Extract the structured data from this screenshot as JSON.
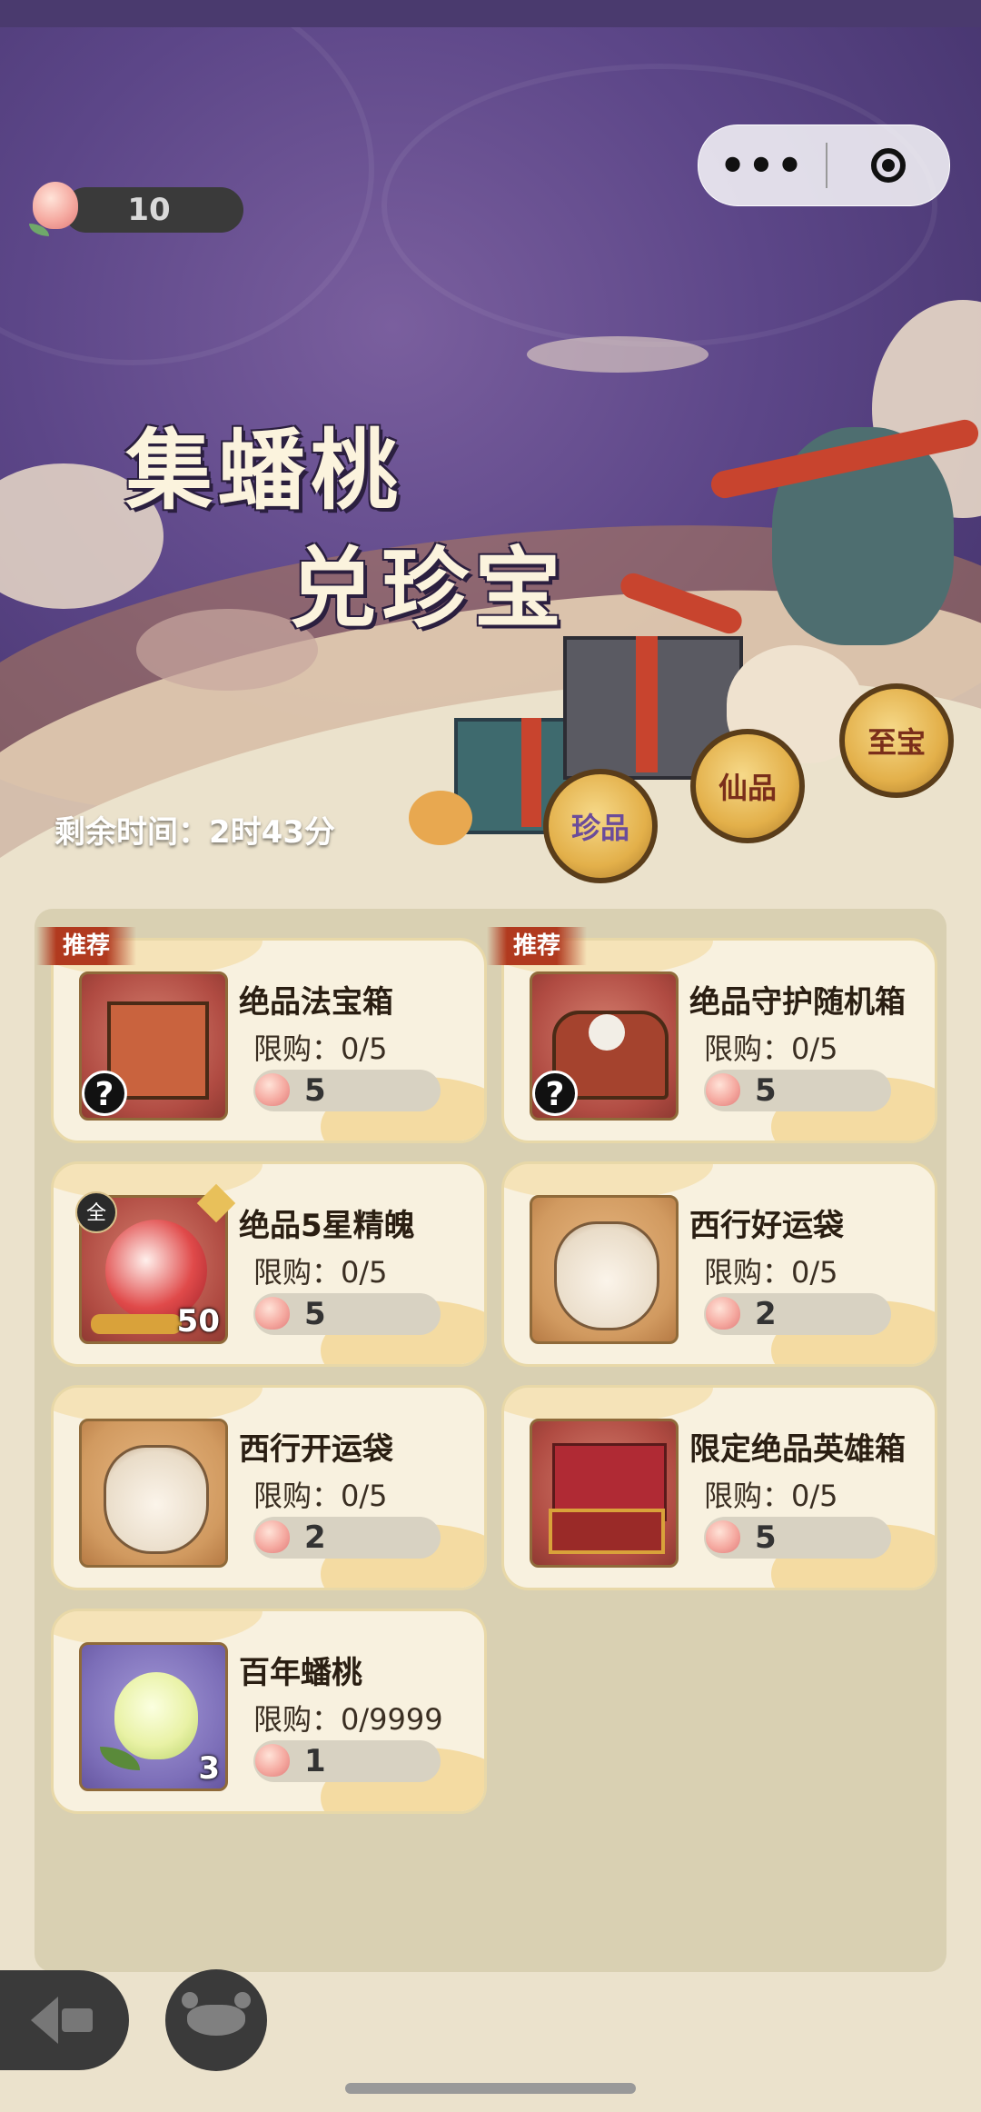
{
  "top_bar": {
    "peach_count": "10",
    "more_glyph": "•••"
  },
  "banner": {
    "title_line1": "集蟠桃",
    "title_line2": "兑珍宝",
    "remaining_time": "剩余时间：2时43分",
    "tiers": [
      {
        "label": "珍品",
        "color": "#6b4c9a"
      },
      {
        "label": "仙品",
        "color": "#7a2e1a"
      },
      {
        "label": "至宝",
        "color": "#7a2e1a"
      }
    ]
  },
  "recommend_tag": "推荐",
  "items": [
    {
      "name": "绝品法宝箱",
      "limit": "限购：0/5",
      "price": "5",
      "recommended": true,
      "mystery": true,
      "bg": "red"
    },
    {
      "name": "绝品守护随机箱",
      "limit": "限购：0/5",
      "price": "5",
      "recommended": true,
      "mystery": true,
      "bg": "red"
    },
    {
      "name": "绝品5星精魄",
      "limit": "限购：0/5",
      "price": "5",
      "recommended": false,
      "badge": "全",
      "quantity": "50",
      "bg": "red"
    },
    {
      "name": "西行好运袋",
      "limit": "限购：0/5",
      "price": "2",
      "recommended": false,
      "bg": "tan"
    },
    {
      "name": "西行开运袋",
      "limit": "限购：0/5",
      "price": "2",
      "recommended": false,
      "bg": "tan"
    },
    {
      "name": "限定绝品英雄箱",
      "limit": "限购：0/5",
      "price": "5",
      "recommended": false,
      "bg": "red"
    },
    {
      "name": "百年蟠桃",
      "limit": "限购：0/9999",
      "price": "1",
      "recommended": false,
      "quantity": "3",
      "bg": "purple"
    }
  ]
}
